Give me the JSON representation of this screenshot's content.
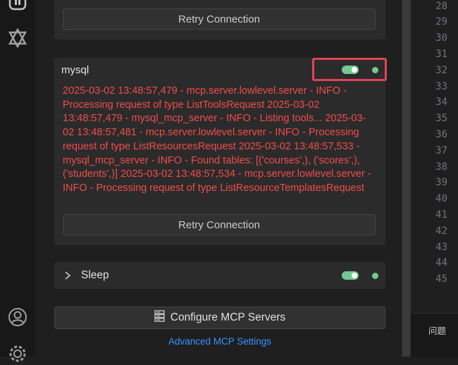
{
  "activity_bar": {
    "top_icon": "extensions-icon",
    "second_icon": "mcp-logo-icon",
    "bottom_icons": [
      "account-icon",
      "settings-gear-icon"
    ]
  },
  "server_card_top": {
    "retry_label": "Retry Connection"
  },
  "mysql_card": {
    "name": "mysql",
    "enabled": true,
    "status": "connected",
    "log": "2025-03-02 13:48:57,479 - mcp.server.lowlevel.server - INFO - Processing request of type ListToolsRequest 2025-03-02 13:48:57,479 - mysql_mcp_server - INFO - Listing tools... 2025-03-02 13:48:57,481 - mcp.server.lowlevel.server - INFO - Processing request of type ListResourcesRequest 2025-03-02 13:48:57,533 - mysql_mcp_server - INFO - Found tables: [('courses',), ('scores',), ('students',)] 2025-03-02 13:48:57,534 - mcp.server.lowlevel.server - INFO - Processing request of type ListResourceTemplatesRequest",
    "retry_label": "Retry Connection"
  },
  "sleep_card": {
    "name": "Sleep",
    "enabled": true,
    "status": "connected"
  },
  "configure_button": {
    "label": "Configure MCP Servers",
    "icon": "server-icon"
  },
  "advanced_link": "Advanced MCP Settings",
  "editor": {
    "line_numbers": [
      "28",
      "29",
      "30",
      "31",
      "32",
      "33",
      "34",
      "35",
      "36",
      "37",
      "38",
      "39",
      "40",
      "41",
      "42",
      "43",
      "44",
      "45"
    ]
  },
  "bottom_panel": {
    "tab_label": "问题"
  },
  "colors": {
    "error": "#f14c4c",
    "success": "#73c991",
    "link": "#3794ff",
    "highlight": "#e0445a"
  }
}
